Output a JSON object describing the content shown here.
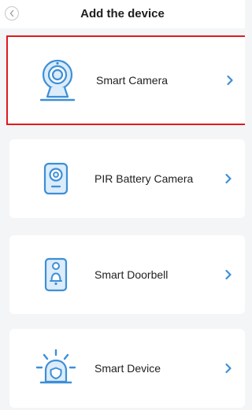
{
  "header": {
    "title": "Add the device",
    "back_icon": "chevron-left-icon"
  },
  "colors": {
    "accent": "#3d8fd6",
    "icon_fill": "#dcecfb",
    "selection_border": "#e0191f",
    "background": "#f4f5f7"
  },
  "devices": [
    {
      "label": "Smart Camera",
      "icon": "smart-camera-icon",
      "selected": true
    },
    {
      "label": "PIR Battery Camera",
      "icon": "battery-camera-icon",
      "selected": false
    },
    {
      "label": "Smart Doorbell",
      "icon": "doorbell-icon",
      "selected": false
    },
    {
      "label": "Smart Device",
      "icon": "alarm-siren-icon",
      "selected": false
    }
  ]
}
